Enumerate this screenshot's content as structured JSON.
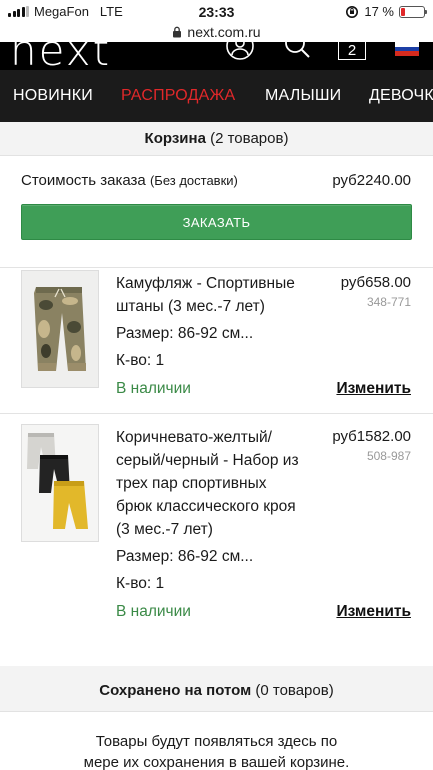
{
  "status_bar": {
    "carrier": "MegaFon",
    "network": "LTE",
    "time": "23:33",
    "battery_percent": "17 %",
    "battery_level": 0.17
  },
  "browser": {
    "url": "next.com.ru"
  },
  "header": {
    "logo": "next",
    "basket_count": "2",
    "flag_colors": [
      "#ffffff",
      "#1c3fa6",
      "#d52b1e"
    ]
  },
  "nav": {
    "items": [
      "НОВИНКИ",
      "РАСПРОДАЖА",
      "МАЛЫШИ",
      "ДЕВОЧКИ"
    ],
    "sale_color": "#e0282a"
  },
  "basket": {
    "title": "Корзина",
    "count": "(2 товаров)",
    "order_cost_label": "Стоимость заказа",
    "order_cost_note": "(Без доставки)",
    "order_total": "руб2240.00",
    "checkout_label": "ЗАКАЗАТЬ",
    "items": [
      {
        "name_lines": [
          "Камуфляж - Спортивные",
          "штаны (3 мес.-7 лет)"
        ],
        "price": "руб658.00",
        "code": "348-771",
        "size": "Размер: 86-92 см...",
        "qty": "К-во: 1",
        "stock": "В наличии",
        "change": "Изменить"
      },
      {
        "name_lines": [
          "Коричневато-желтый/",
          "серый/черный - Набор из",
          "трех пар спортивных",
          "брюк классического кроя",
          "(3 мес.-7 лет)"
        ],
        "price": "руб1582.00",
        "code": "508-987",
        "size": "Размер: 86-92 см...",
        "qty": "К-во: 1",
        "stock": "В наличии",
        "change": "Изменить"
      }
    ]
  },
  "saved": {
    "title": "Сохранено на потом",
    "count": "(0 товаров)",
    "text_line1": "Товары будут появляться здесь по",
    "text_line2": "мере их сохранения в вашей корзине."
  }
}
